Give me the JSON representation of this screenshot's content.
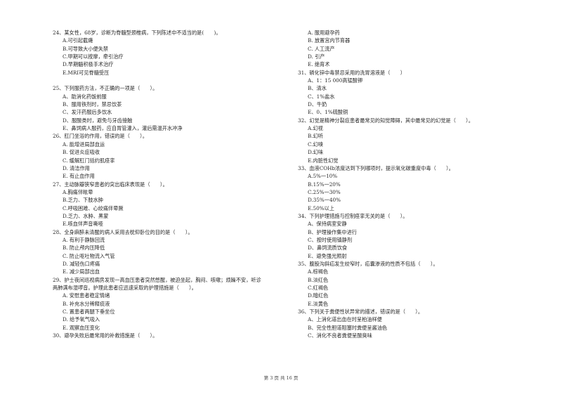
{
  "left_column": {
    "q24": {
      "stem": "24、某女性，68岁，诊断为脊髓型颈椎病，下列陈述中不适当的是(　　)。",
      "options": [
        "A.可引起截瘫",
        "B.可导致大小便失禁",
        "C.甲期可以按摩，牵引治疗",
        "D.早期髓积极手术治疗",
        "E.MRI可见脊髓受压"
      ]
    },
    "q25": {
      "stem": "25、下列服药方法，不正确的一项是（　　）。",
      "options": [
        "A、助消化药饭前服",
        "B、服用铁剂时，禁忌饮茶",
        "C、发汗药服后多饮水",
        "D、服酸类时，避免与牙齿接触",
        "E、鼻饲病人服药，应自胃管灌入，灌后需温开水冲净"
      ]
    },
    "q26": {
      "stem": "26、肛门坐浴的作用，错误的是（　　）。",
      "options": [
        "A. 能增进局部血运",
        "B. 促进炎症吸收",
        "C. 缓解肛门括约肌痉挛",
        "D. 清洁作用",
        "E. 有止血作用"
      ]
    },
    "q27": {
      "stem": "27、主动脉瓣狭窄患者的突出临床表现是（　　）。",
      "options": [
        "A.胸痛伴眩晕",
        "B.乏力、下肢水肿",
        "C.呼吸困难、心绞痛伴晕厥",
        "D.乏力、水肿、黑蒙",
        "E.咳血伴声音嘶哑"
      ]
    },
    "q28": {
      "stem": "28、全身麻醉未清醒的病人采用去枕仰卧位的目的是（　　）。",
      "options": [
        "A. 有利于静脉回流",
        "B. 防止颅内压降低",
        "C. 防止呕吐物流入气管",
        "D. 减轻伤口疼痛",
        "E. 减少局部出血"
      ]
    },
    "q29": {
      "stem_line1": "29、护士夜间巡视病房发现一高血压患者突然憋醒，被迫坐起，胸闷、咳嗽；烦躁不安，听诊",
      "stem_line2": "两肺满布湿啰音。护理此患者应迅速采取的护理措施是（　　）。",
      "options": [
        "A. 安慰患者稳定情绪",
        "B. 补充水分稀释痰液",
        "C. 置患者两腿下垂坐位",
        "D. 给予氧气吸入",
        "E. 观察血压变化"
      ]
    },
    "q30": {
      "stem": "30、避孕失败后最常用的补救措施是（　　）。"
    }
  },
  "right_column": {
    "q30_options": [
      "A. 服用避孕药",
      "B. 放置宫内节育器",
      "C. 人工流产",
      "D. 引产",
      "E. 绝育术"
    ],
    "q31": {
      "stem": "31、磷化锌中毒禁忌采用的洗胃溶液是（　　）",
      "options": [
        "A、1：15 000高锰酸钾",
        "B、清水",
        "C、1%盐水",
        "D、牛奶",
        "E、0、1%硫酸铜"
      ]
    },
    "q32": {
      "stem": "32、幻觉是精神分裂症患者最常见的知觉障碍，其中最常见的幻觉是（　　）。",
      "options": [
        "A.幻视",
        "B.幻听",
        "C.幻嗅",
        "D.幻味",
        "E.内脏性幻觉"
      ]
    },
    "q33": {
      "stem": "33、血液COHb浓度达到下列哪项时，提示氧化碳重度中毒（　　）。",
      "options": [
        "A.5%一10%",
        "B.15%一20%",
        "C.25%一30%",
        "D.35%一40%",
        "E.50%以上"
      ]
    },
    "q34": {
      "stem": "34、下列护理措施与控制痉挛无关的是（　　）。",
      "options": [
        "A、保持病室安静",
        "B、护理操作集中进行",
        "C、按时使用镇静剂",
        "D、鼻饲流质饮食",
        "E、避免强光照射"
      ]
    },
    "q35": {
      "stem": "35、腹股沟斜疝发生绞窄时，疝囊渗液的性质不包括（　　）。",
      "options": [
        "A.棕褐色",
        "B.淡红色",
        "C.红褐色",
        "D.暗红色",
        "E.淡黄色"
      ]
    },
    "q36": {
      "stem": "36、下列关于粪便性状异常的描述，错误的是（　　）。",
      "options": [
        "A、上消化道出血在时呈柏油样便",
        "B、完全性胆道阻塞时粪便呈酱油色",
        "C、消化不良者粪便呈酸臭味"
      ]
    }
  },
  "footer": {
    "page_indicator": "第 3 页 共 16 页"
  }
}
